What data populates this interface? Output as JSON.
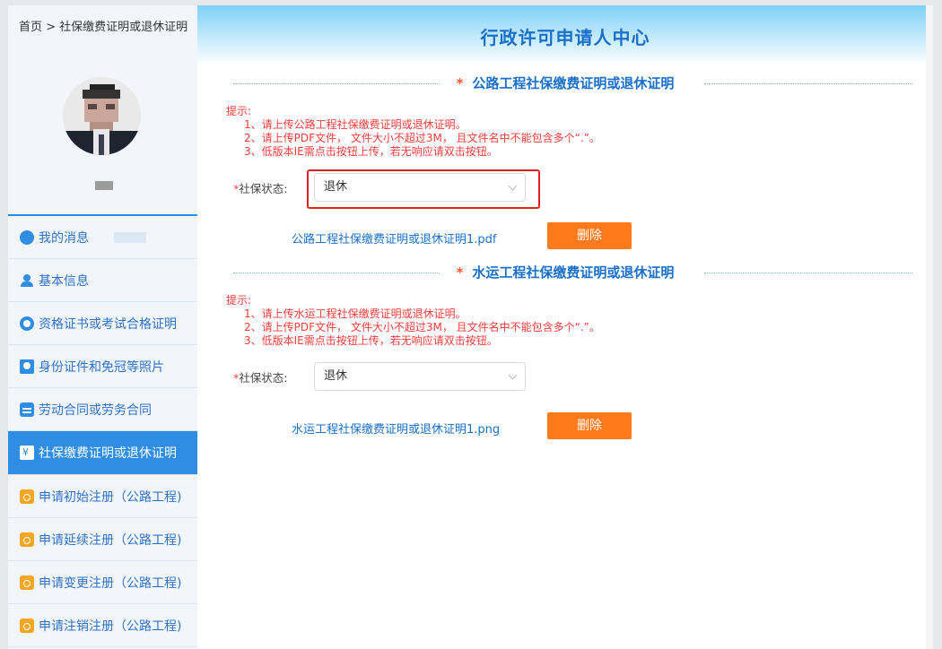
{
  "breadcrumb": "首页 > 社保缴费证明或退休证明",
  "header": {
    "title": "行政许可申请人中心"
  },
  "sidebar": {
    "items": [
      {
        "label": "我的消息",
        "icon": "message-icon"
      },
      {
        "label": "基本信息",
        "icon": "user-icon"
      },
      {
        "label": "资格证书或考试合格证明",
        "icon": "certificate-icon"
      },
      {
        "label": "身份证件和免冠等照片",
        "icon": "id-card-icon"
      },
      {
        "label": "劳动合同或劳务合同",
        "icon": "contract-icon"
      },
      {
        "label": "社保缴费证明或退休证明",
        "icon": "social-security-icon",
        "active": true
      },
      {
        "label": "申请初始注册（公路工程)",
        "icon": "briefcase-icon"
      },
      {
        "label": "申请延续注册（公路工程)",
        "icon": "briefcase-icon"
      },
      {
        "label": "申请变更注册（公路工程)",
        "icon": "briefcase-icon"
      },
      {
        "label": "申请注销注册（公路工程)",
        "icon": "briefcase-icon"
      }
    ]
  },
  "sections": [
    {
      "star": "*",
      "title": "公路工程社保缴费证明或退休证明",
      "tips_title": "提示:",
      "tips": [
        "1、请上传公路工程社保缴费证明或退休证明。",
        "2、请上传PDF文件， 文件大小不超过3M， 且文件名中不能包含多个“.”。",
        "3、低版本IE需点击按钮上传，若无响应请双击按钮。"
      ],
      "status_label_req": "*",
      "status_label": "社保状态:",
      "status_value": "退休",
      "file_name": "公路工程社保缴费证明或退休证明1.pdf",
      "delete_label": "删除"
    },
    {
      "star": "*",
      "title": "水运工程社保缴费证明或退休证明",
      "tips_title": "提示:",
      "tips": [
        "1、请上传水运工程社保缴费证明或退休证明。",
        "2、请上传PDF文件， 文件大小不超过3M， 且文件名中不能包含多个“.”。",
        "3、低版本IE需点击按钮上传，若无响应请双击按钮。"
      ],
      "status_label_req": "*",
      "status_label": "社保状态:",
      "status_value": "退休",
      "file_name": "水运工程社保缴费证明或退休证明1.png",
      "delete_label": "删除"
    }
  ],
  "colors": {
    "accent": "#2f8de4",
    "title_blue": "#1a6fc8",
    "tip_red": "#f23c3c",
    "delete_orange": "#ff7a1a",
    "highlight_red": "#e02020"
  }
}
